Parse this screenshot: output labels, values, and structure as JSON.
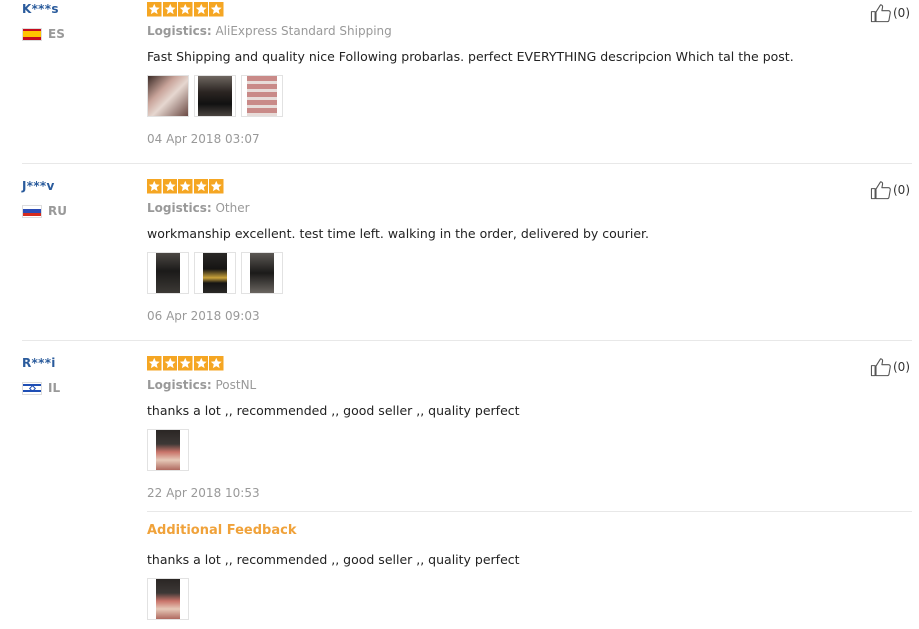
{
  "reviews": [
    {
      "user": "K***s",
      "country": "ES",
      "logistics_label": "Logistics:",
      "logistics_value": "AliExpress Standard Shipping",
      "text": "Fast Shipping and quality nice Following probarlas. perfect EVERYTHING descripcion Which tal the post.",
      "date": "04 Apr 2018 03:07",
      "likes": "(0)",
      "rating": 5
    },
    {
      "user": "J***v",
      "country": "RU",
      "logistics_label": "Logistics:",
      "logistics_value": "Other",
      "text": "workmanship excellent. test time left. walking in the order, delivered by courier.",
      "date": "06 Apr 2018 09:03",
      "likes": "(0)",
      "rating": 5
    },
    {
      "user": "R***i",
      "country": "IL",
      "logistics_label": "Logistics:",
      "logistics_value": "PostNL",
      "text": "thanks a lot ,, recommended ,, good seller ,, quality perfect",
      "date": "22 Apr 2018 10:53",
      "likes": "(0)",
      "rating": 5,
      "additional_title": "Additional Feedback",
      "additional_text": "thanks a lot ,, recommended ,, good seller ,, quality perfect"
    }
  ],
  "colors": {
    "star": "#f5a623",
    "username": "#2a5b9c",
    "additional": "#f0a23a"
  }
}
